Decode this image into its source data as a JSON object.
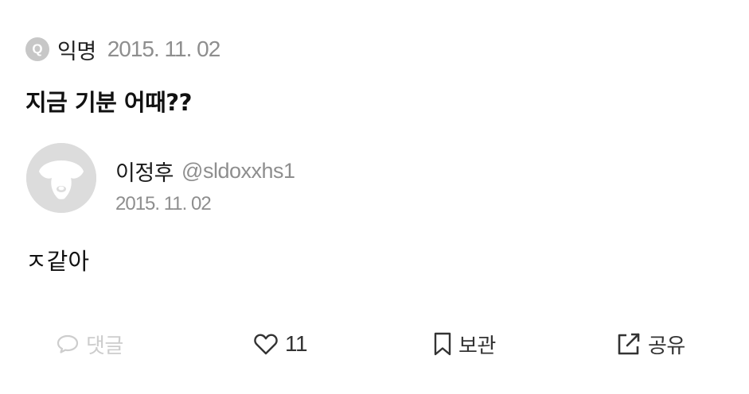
{
  "question": {
    "badge": "Q",
    "author": "익명",
    "date": "2015. 11. 02",
    "text": "지금 기분 어때??"
  },
  "answer": {
    "avatar_icon": "dog-avatar-icon",
    "author": "이정후",
    "handle": "@sldoxxhs1",
    "date": "2015. 11. 02",
    "text": "ㅈ같아"
  },
  "actions": {
    "comment": {
      "icon": "comment-bubble-icon",
      "label": "댓글",
      "disabled": true
    },
    "like": {
      "icon": "heart-icon",
      "count": "11"
    },
    "bookmark": {
      "icon": "bookmark-icon",
      "label": "보관"
    },
    "share": {
      "icon": "share-external-icon",
      "label": "공유"
    }
  },
  "colors": {
    "text_primary": "#111111",
    "text_secondary": "#8e8e8e",
    "badge_bg": "#c7c7c7",
    "avatar_bg": "#dcdcdc",
    "disabled": "#cdcdcd"
  }
}
